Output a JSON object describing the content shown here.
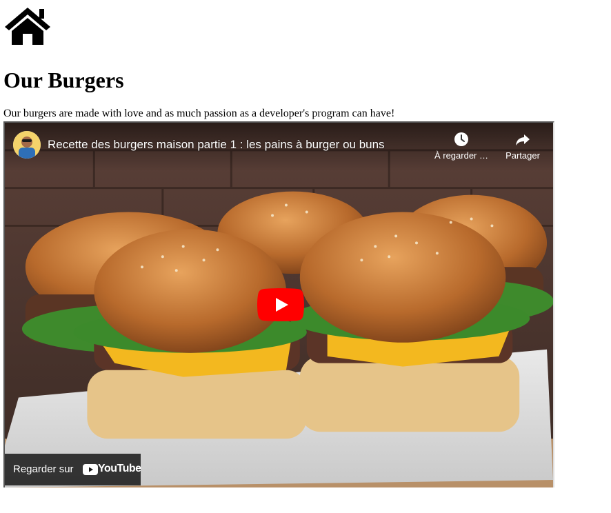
{
  "nav": {
    "home_icon": "home-icon"
  },
  "page": {
    "title": "Our Burgers",
    "tagline": "Our burgers are made with love and as much passion as a developer's program can have!"
  },
  "video": {
    "title": "Recette des burgers maison partie 1 : les pains à burger ou buns",
    "watch_later_label": "À regarder …",
    "share_label": "Partager",
    "watch_on_label": "Regarder sur",
    "youtube_wordmark": "YouTube",
    "icons": {
      "watch_later": "clock-icon",
      "share": "share-arrow-icon",
      "play": "play-icon",
      "avatar": "channel-avatar"
    },
    "colors": {
      "play_red": "#ff0000",
      "overlay": "#171717"
    }
  }
}
